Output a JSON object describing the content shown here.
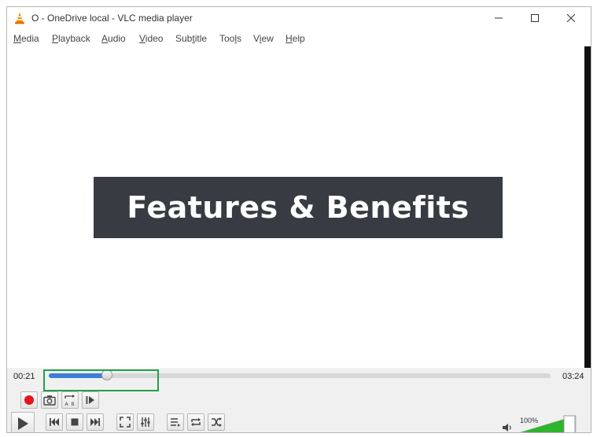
{
  "window": {
    "title": "O - OneDrive local - VLC media player",
    "app_icon": "vlc-cone-icon",
    "buttons": [
      "minimize-icon",
      "maximize-icon",
      "close-icon"
    ]
  },
  "menu": {
    "items": [
      {
        "pre": "",
        "u": "M",
        "post": "edia"
      },
      {
        "pre": "",
        "u": "P",
        "post": "layback"
      },
      {
        "pre": "",
        "u": "A",
        "post": "udio"
      },
      {
        "pre": "",
        "u": "V",
        "post": "ideo"
      },
      {
        "pre": "Sub",
        "u": "t",
        "post": "itle"
      },
      {
        "pre": "Too",
        "u": "l",
        "post": "s"
      },
      {
        "pre": "V",
        "u": "i",
        "post": "ew"
      },
      {
        "pre": "",
        "u": "H",
        "post": "elp"
      }
    ]
  },
  "video": {
    "banner_text": "Features & Benefits",
    "banner_color": "#383c42"
  },
  "playback": {
    "elapsed": "00:21",
    "total": "03:24",
    "progress_fraction": 0.103,
    "seek_color": "#3c7fd6",
    "highlight_color": "#22a04a"
  },
  "volume": {
    "level_label": "100%",
    "level_fraction": 1.0,
    "color": "#2db52d"
  }
}
